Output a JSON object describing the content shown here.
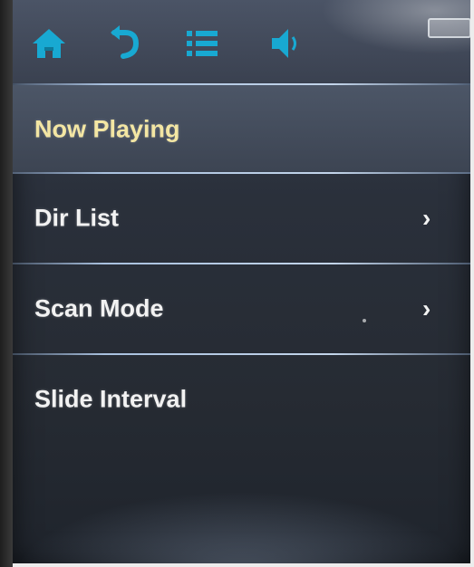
{
  "toolbar": {
    "icons": [
      "home-icon",
      "back-icon",
      "list-icon",
      "volume-icon",
      "battery-icon"
    ],
    "icon_color": "#18a9d2"
  },
  "menu": {
    "items": [
      {
        "label": "Now Playing",
        "selected": true,
        "has_submenu": false
      },
      {
        "label": "Dir List",
        "selected": false,
        "has_submenu": true,
        "chevron": "›"
      },
      {
        "label": "Scan Mode",
        "selected": false,
        "has_submenu": true,
        "chevron": "›"
      },
      {
        "label": "Slide Interval",
        "selected": false,
        "has_submenu": false
      }
    ],
    "selected_color": "#f3e6a3",
    "text_color": "#f2f2f2"
  }
}
